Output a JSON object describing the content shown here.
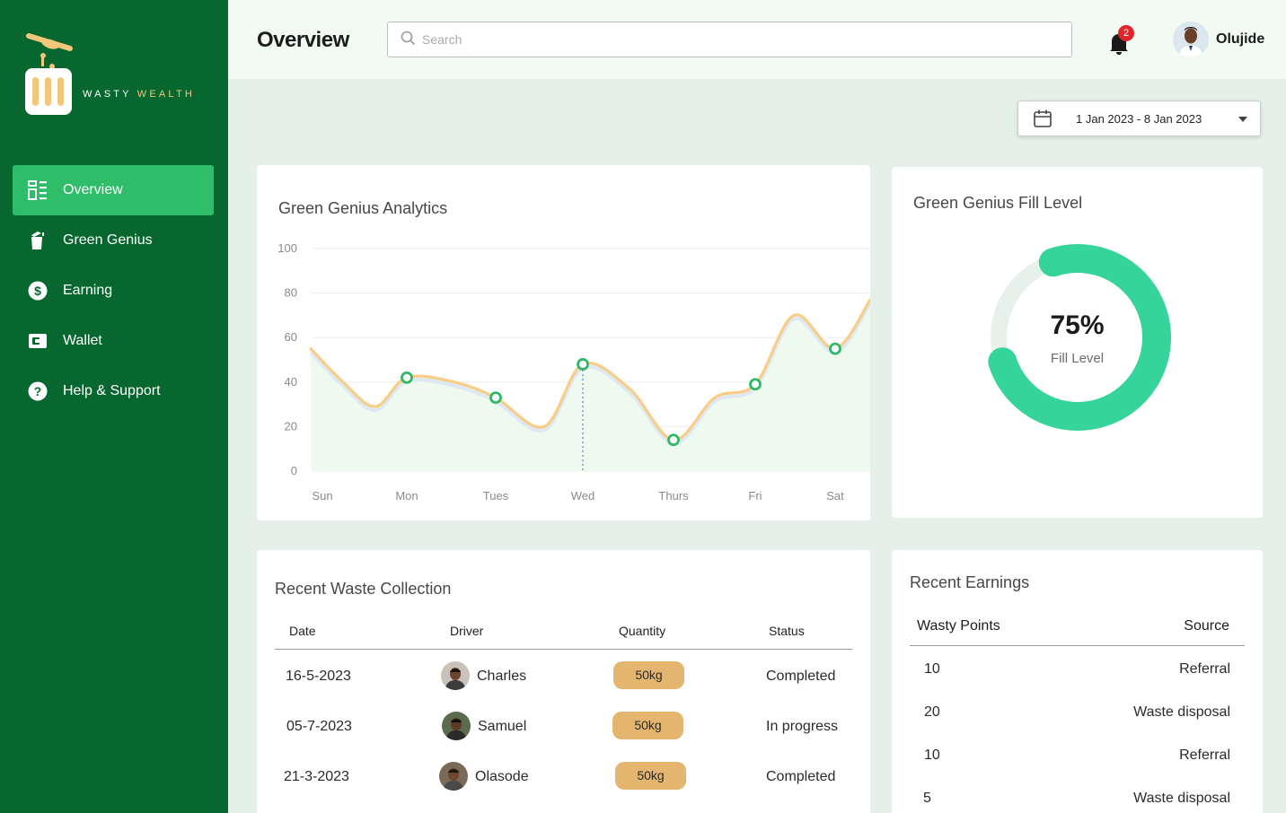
{
  "brand": {
    "name_part1": "WASTY",
    "name_part2": "WEALTH"
  },
  "sidebar": {
    "items": [
      {
        "label": "Overview",
        "icon": "dashboard-icon",
        "active": true
      },
      {
        "label": "Green Genius",
        "icon": "bin-icon",
        "active": false
      },
      {
        "label": "Earning",
        "icon": "dollar-icon",
        "active": false
      },
      {
        "label": "Wallet",
        "icon": "wallet-icon",
        "active": false
      },
      {
        "label": "Help & Support",
        "icon": "help-icon",
        "active": false
      }
    ]
  },
  "header": {
    "title": "Overview",
    "search_placeholder": "Search",
    "notification_count": "2",
    "user_name": "Olujide"
  },
  "date_range": {
    "label": "1 Jan 2023 - 8 Jan 2023"
  },
  "analytics": {
    "title": "Green Genius Analytics",
    "chart_data": {
      "type": "line",
      "categories": [
        "Sun",
        "Mon",
        "Tues",
        "Wed",
        "Thurs",
        "Fri",
        "Sat"
      ],
      "yticks": [
        0,
        20,
        40,
        60,
        80,
        100
      ],
      "ylim": [
        0,
        100
      ],
      "markers": [
        {
          "x": "Mon",
          "y": 42
        },
        {
          "x": "Tues",
          "y": 33
        },
        {
          "x": "Wed",
          "y": 48
        },
        {
          "x": "Thurs",
          "y": 14
        },
        {
          "x": "Fri",
          "y": 39
        },
        {
          "x": "Sat",
          "y": 55
        }
      ],
      "highlight": "Wed",
      "line_color": "#f9cd86",
      "marker_color": "#2fb866",
      "area_color": "#eefaf0"
    }
  },
  "fill_level": {
    "title": "Green Genius Fill Level",
    "percent_text": "75%",
    "label": "Fill Level",
    "value": 0.75,
    "accent": "#35d49a",
    "track": "#e6f1ec"
  },
  "waste": {
    "title": "Recent Waste Collection",
    "columns": [
      "Date",
      "Driver",
      "Quantity",
      "Status"
    ],
    "rows": [
      {
        "date": "16-5-2023",
        "driver": "Charles",
        "quantity": "50kg",
        "status": "Completed"
      },
      {
        "date": "05-7-2023",
        "driver": "Samuel",
        "quantity": "50kg",
        "status": "In progress"
      },
      {
        "date": "21-3-2023",
        "driver": "Olasode",
        "quantity": "50kg",
        "status": "Completed"
      }
    ]
  },
  "earnings": {
    "title": "Recent Earnings",
    "columns": [
      "Wasty Points",
      "Source"
    ],
    "rows": [
      {
        "points": "10",
        "source": "Referral"
      },
      {
        "points": "20",
        "source": "Waste disposal"
      },
      {
        "points": "10",
        "source": "Referral"
      },
      {
        "points": "5",
        "source": "Waste disposal"
      }
    ]
  }
}
